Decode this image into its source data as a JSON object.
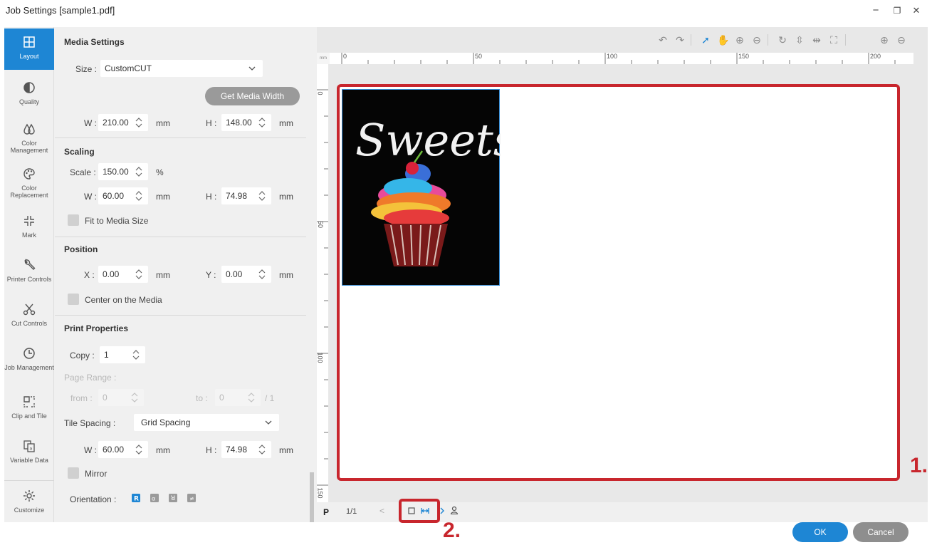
{
  "window": {
    "title": "Job Settings [sample1.pdf]",
    "minimize": "−",
    "restore": "❐",
    "close": "✕"
  },
  "sidebar": {
    "items": [
      {
        "label": "Layout",
        "icon": "layout-icon"
      },
      {
        "label": "Quality",
        "icon": "quality-icon"
      },
      {
        "label": "Color Management",
        "icon": "color-management-icon"
      },
      {
        "label": "Color Replacement",
        "icon": "palette-icon"
      },
      {
        "label": "Mark",
        "icon": "mark-icon"
      },
      {
        "label": "Printer Controls",
        "icon": "wrench-icon"
      },
      {
        "label": "Cut Controls",
        "icon": "scissors-icon"
      },
      {
        "label": "Job Management",
        "icon": "clock-icon"
      },
      {
        "label": "Clip and Tile",
        "icon": "clip-tile-icon"
      },
      {
        "label": "Variable Data",
        "icon": "variable-data-icon"
      },
      {
        "label": "Customize",
        "icon": "gear-icon"
      }
    ]
  },
  "media_settings": {
    "title": "Media Settings",
    "size_label": "Size :",
    "size_value": "CustomCUT",
    "get_media_width": "Get Media Width",
    "w_label": "W :",
    "w_value": "210.00",
    "w_unit": "mm",
    "h_label": "H :",
    "h_value": "148.00",
    "h_unit": "mm"
  },
  "scaling": {
    "title": "Scaling",
    "scale_label": "Scale :",
    "scale_value": "150.00",
    "scale_unit": "%",
    "w_label": "W :",
    "w_value": "60.00",
    "w_unit": "mm",
    "h_label": "H :",
    "h_value": "74.98",
    "h_unit": "mm",
    "fit_label": "Fit to Media Size"
  },
  "position": {
    "title": "Position",
    "x_label": "X :",
    "x_value": "0.00",
    "x_unit": "mm",
    "y_label": "Y :",
    "y_value": "0.00",
    "y_unit": "mm",
    "center_label": "Center on the Media"
  },
  "print_properties": {
    "title": "Print Properties",
    "copy_label": "Copy :",
    "copy_value": "1",
    "page_range_label": "Page Range :",
    "from_label": "from :",
    "from_value": "0",
    "to_label": "to :",
    "to_value": "0",
    "total": "/ 1",
    "tile_spacing_label": "Tile Spacing :",
    "tile_spacing_value": "Grid Spacing",
    "w_label": "W :",
    "w_value": "60.00",
    "w_unit": "mm",
    "h_label": "H :",
    "h_value": "74.98",
    "h_unit": "mm",
    "mirror_label": "Mirror",
    "orientation_label": "Orientation :"
  },
  "ruler": {
    "unit": "mm",
    "h_labels": [
      "0",
      "50",
      "100",
      "150",
      "200"
    ],
    "v_labels": [
      "0",
      "50",
      "100",
      "150"
    ]
  },
  "artwork": {
    "text": "Sweets"
  },
  "navigation": {
    "p_label": "P",
    "page_count": "1/1",
    "prev": "<"
  },
  "callouts": {
    "one": "1.",
    "two": "2."
  },
  "footer": {
    "ok": "OK",
    "cancel": "Cancel"
  },
  "colors": {
    "accent": "#1e86d4",
    "callout": "#c8262d"
  }
}
